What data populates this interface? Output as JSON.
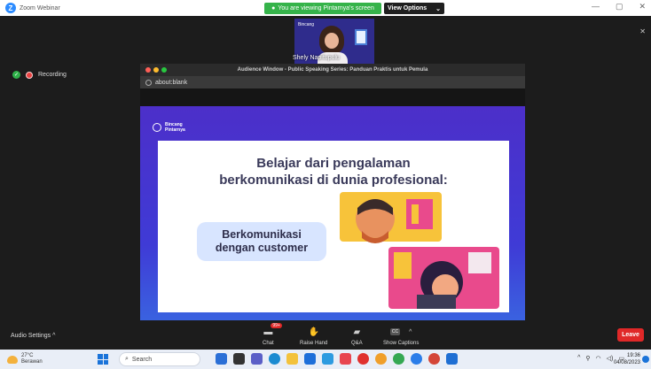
{
  "zoom": {
    "title": "Zoom Webinar",
    "screen_banner": "You are viewing Pintarnya's screen",
    "view_options": "View Options",
    "recording": "Recording"
  },
  "video": {
    "participant_name": "Shely Napitupulu",
    "brand": "Bincang"
  },
  "audience_window": {
    "title": "Audience Window - Public Speaking Series: Panduan Praktis untuk Pemula",
    "url": "about:blank"
  },
  "slide": {
    "logo_line1": "Bincang",
    "logo_line2": "Pintarnya",
    "heading_line1": "Belajar dari pengalaman",
    "heading_line2": "berkomunikasi di dunia profesional:",
    "pill_line1": "Berkomunikasi",
    "pill_line2": "dengan customer"
  },
  "controls": {
    "audio_settings": "Audio Settings",
    "chat": "Chat",
    "chat_badge": "99+",
    "raise_hand": "Raise Hand",
    "qa": "Q&A",
    "show_captions": "Show Captions",
    "cc": "CC",
    "leave": "Leave"
  },
  "taskbar": {
    "temperature": "27°C",
    "weather_desc": "Berawan",
    "search": "Search",
    "time": "19:36",
    "date": "04/08/2023"
  },
  "colors": {
    "zoom_blue": "#2d8cff",
    "banner_green": "#35b34a",
    "leave_red": "#e02828",
    "slide_purple": "#4c2fc9"
  }
}
